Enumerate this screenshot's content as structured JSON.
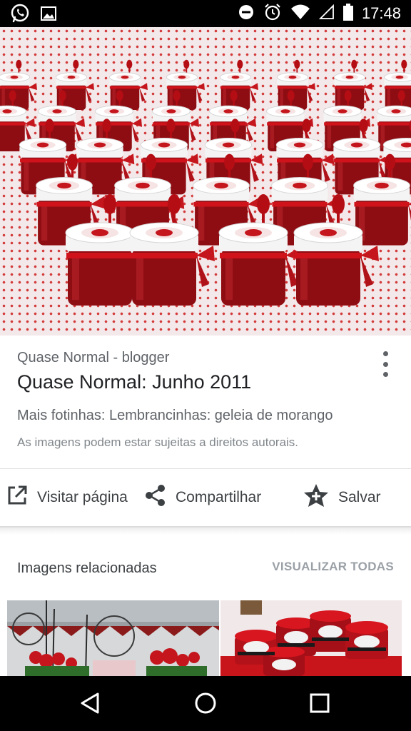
{
  "status_bar": {
    "time": "17:48",
    "left_icons": [
      "whatsapp-icon",
      "image-icon"
    ],
    "right_icons": [
      "do-not-disturb-icon",
      "alarm-icon",
      "wifi-icon",
      "signal-icon",
      "battery-icon"
    ]
  },
  "result": {
    "source": "Quase Normal - blogger",
    "title": "Quase Normal: Junho 2011",
    "description": "Mais fotinhas: Lembrancinhas: geleia de morango",
    "copyright": "As imagens podem estar sujeitas a direitos autorais."
  },
  "actions": {
    "visit_label": "Visitar página",
    "share_label": "Compartilhar",
    "save_label": "Salvar"
  },
  "related": {
    "title": "Imagens relacionadas",
    "view_all": "VISUALIZAR TODAS"
  },
  "colors": {
    "accent_red": "#c4161c",
    "text_primary": "#202124",
    "text_secondary": "#5f6368"
  }
}
